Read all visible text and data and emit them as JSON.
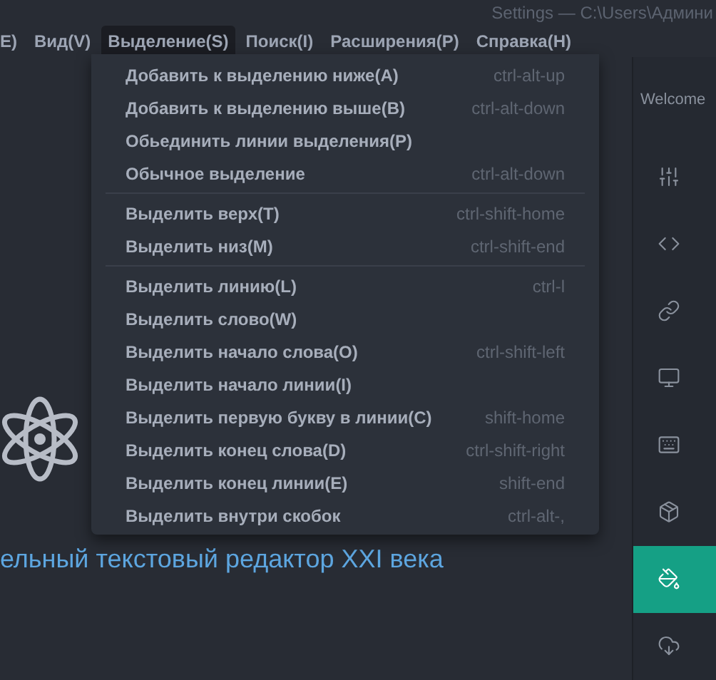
{
  "window": {
    "title": "Settings — C:\\Users\\Админи"
  },
  "menu_bar": [
    {
      "label": "E)",
      "selected": false
    },
    {
      "label": "Вид(V)",
      "selected": false
    },
    {
      "label": "Выделение(S)",
      "selected": true
    },
    {
      "label": "Поиск(I)",
      "selected": false
    },
    {
      "label": "Расширения(P)",
      "selected": false
    },
    {
      "label": "Справка(H)",
      "selected": false
    }
  ],
  "menu": {
    "groups": [
      [
        {
          "label": "Добавить к выделению ниже(A)",
          "shortcut": "ctrl-alt-up"
        },
        {
          "label": "Добавить к выделению выше(B)",
          "shortcut": "ctrl-alt-down"
        },
        {
          "label": "Обьединить линии выделения(P)"
        },
        {
          "label": "Обычное выделение",
          "shortcut": "ctrl-alt-down"
        }
      ],
      [
        {
          "label": "Выделить верх(T)",
          "shortcut": "ctrl-shift-home"
        },
        {
          "label": "Выделить низ(M)",
          "shortcut": "ctrl-shift-end"
        }
      ],
      [
        {
          "label": "Выделить линию(L)",
          "shortcut": "ctrl-l"
        },
        {
          "label": "Выделить слово(W)"
        },
        {
          "label": "Выделить начало слова(O)",
          "shortcut": "ctrl-shift-left"
        },
        {
          "label": "Выделить начало линии(I)"
        },
        {
          "label": "Выделить первую букву в линии(C)",
          "shortcut": "shift-home"
        },
        {
          "label": "Выделить конец слова(D)",
          "shortcut": "ctrl-shift-right"
        },
        {
          "label": "Выделить конец линии(E)",
          "shortcut": "shift-end"
        },
        {
          "label": "Выделить внутри скобок",
          "shortcut": "ctrl-alt-,"
        }
      ]
    ]
  },
  "welcome": {
    "tagline": "ельный текстовый редактор XXI века"
  },
  "settings_panel": {
    "tab": "Welcome",
    "items": [
      {
        "kind": "sliders",
        "selected": false
      },
      {
        "kind": "code",
        "selected": false
      },
      {
        "kind": "link",
        "selected": false
      },
      {
        "kind": "monitor",
        "selected": false
      },
      {
        "kind": "keyboard",
        "selected": false
      },
      {
        "kind": "package",
        "selected": false
      },
      {
        "kind": "paint",
        "selected": true
      },
      {
        "kind": "cloud",
        "selected": false
      }
    ]
  }
}
